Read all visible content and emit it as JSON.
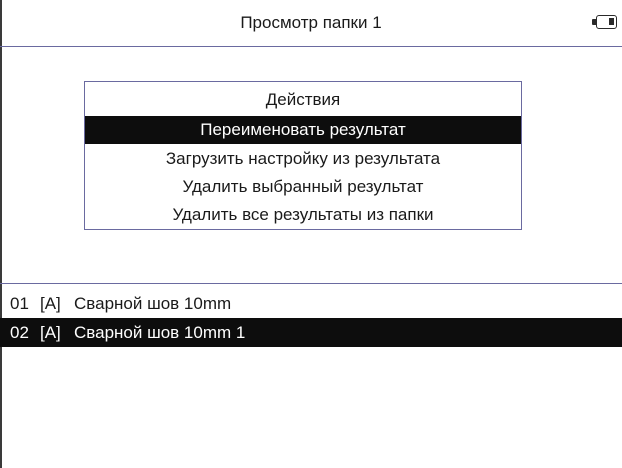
{
  "header": {
    "title": "Просмотр папки 1",
    "battery_icon": "battery-icon",
    "battery_level": 0.3
  },
  "dialog": {
    "title": "Действия",
    "items": [
      {
        "label": "Переименовать результат",
        "selected": true
      },
      {
        "label": "Загрузить настройку из результата",
        "selected": false
      },
      {
        "label": "Удалить выбранный результат",
        "selected": false
      },
      {
        "label": "Удалить все результаты из папки",
        "selected": false
      }
    ]
  },
  "results": [
    {
      "num": "01",
      "type": "[A]",
      "name": "Сварной шов 10mm",
      "selected": false
    },
    {
      "num": "02",
      "type": "[A]",
      "name": "Сварной шов 10mm 1",
      "selected": true
    }
  ],
  "colors": {
    "selection_bg": "#0d0d0d",
    "divider": "#6a6aa0"
  }
}
